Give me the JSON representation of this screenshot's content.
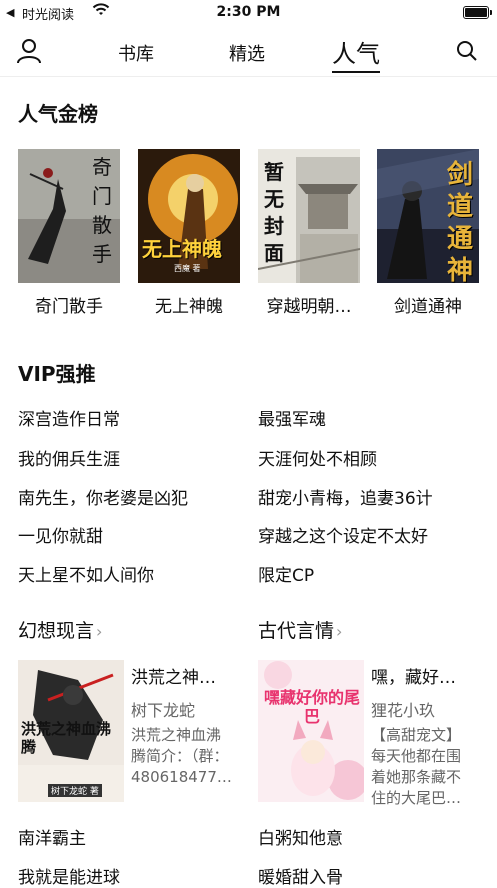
{
  "status_bar": {
    "carrier": "时光阅读",
    "time": "2:30 PM"
  },
  "nav": {
    "tabs": [
      "书库",
      "精选",
      "人气"
    ]
  },
  "hot": {
    "title": "人气金榜",
    "books": [
      {
        "title": "奇门散手",
        "cover_text": "奇门散手"
      },
      {
        "title": "无上神魄",
        "cover_text": "无上神魄",
        "cover_sub": "西魔 著"
      },
      {
        "title": "穿越明朝…",
        "cover_text": "暂无封面"
      },
      {
        "title": "剑道通神",
        "cover_text": "剑道通神"
      }
    ]
  },
  "vip": {
    "title": "VIP强推",
    "left": [
      "深宫造作日常",
      "我的佣兵生涯",
      "南先生，你老婆是凶犯",
      "一见你就甜",
      "天上星不如人间你"
    ],
    "right": [
      "最强军魂",
      "天涯何处不相顾",
      "甜宠小青梅，追妻36计",
      "穿越之这个设定不太好",
      "限定CP"
    ]
  },
  "categories": [
    {
      "title": "幻想现言",
      "book": {
        "name": "洪荒之神…",
        "author": "树下龙蛇",
        "desc": "洪荒之神血沸腾简介：（群：480618477…",
        "cover_text": "洪荒之神血沸腾",
        "cover_sub": "树下龙蛇 著"
      },
      "links": [
        "南洋霸主",
        "我就是能进球"
      ]
    },
    {
      "title": "古代言情",
      "book": {
        "name": "嘿，藏好…",
        "author": "狸花小玖",
        "desc": "【高甜宠文】每天他都在围着她那条藏不住的大尾巴…",
        "cover_text": "嘿藏好你的尾巴"
      },
      "links": [
        "白粥知他意",
        "暖婚甜入骨"
      ]
    }
  ]
}
